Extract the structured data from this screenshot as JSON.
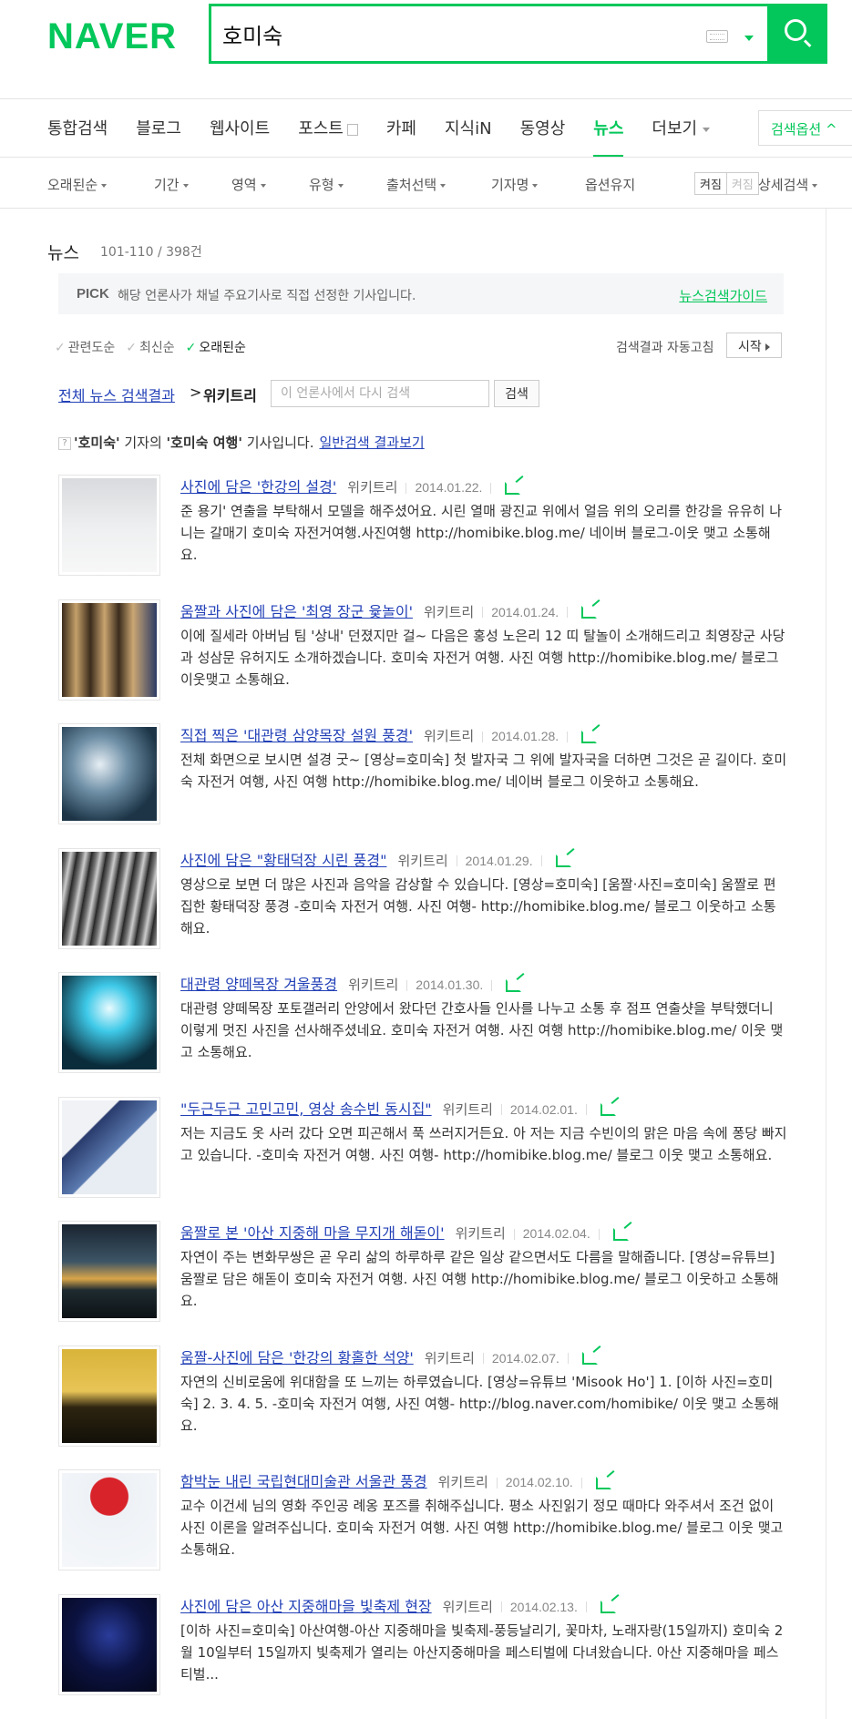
{
  "header": {
    "logo": "NAVER",
    "search_value": "호미숙"
  },
  "tabs": [
    {
      "label": "통합검색"
    },
    {
      "label": "블로그"
    },
    {
      "label": "웹사이트"
    },
    {
      "label": "포스트"
    },
    {
      "label": "카페"
    },
    {
      "label": "지식iN"
    },
    {
      "label": "동영상"
    },
    {
      "label": "뉴스",
      "active": true
    },
    {
      "label": "더보기"
    }
  ],
  "search_options_label": "검색옵션",
  "filters": {
    "sort": "오래된순",
    "period": "기간",
    "area": "영역",
    "type": "유형",
    "source": "출처선택",
    "reporter": "기자명",
    "option_keep": "옵션유지",
    "toggle_on": "켜짐",
    "toggle_off": "켜짐",
    "detail": "상세검색"
  },
  "news": {
    "title": "뉴스",
    "count": "101-110 / 398건",
    "pick_badge": "PICK",
    "pick_text": "해당 언론사가 채널 주요기사로 직접 선정한 기사입니다.",
    "pick_guide": "뉴스검색가이드",
    "sorts": [
      "관련도순",
      "최신순",
      "오래된순"
    ],
    "auto_refresh_label": "검색결과 자동고침",
    "auto_refresh_button": "시작",
    "breadcrumb_all": "전체 뉴스 검색결과",
    "breadcrumb_sep": ">",
    "breadcrumb_current": "위키트리",
    "in_search_placeholder": "이 언론사에서 다시 검색",
    "in_search_button": "검색",
    "notice_pre": "'호미숙'",
    "notice_mid": " 기자의 ",
    "notice_kw": "'호미숙 여행'",
    "notice_post": " 기사입니다.",
    "notice_link": "일반검색 결과보기"
  },
  "results": [
    {
      "headline": "사진에 담은 '한강의 설경'",
      "press": "위키트리",
      "date": "2014.01.22.",
      "thumb": "snow",
      "desc": "준 용기' 연출을 부탁해서 모델을 해주셨어요. 시린 열매 광진교 위에서 얼음 위의 오리를 한강을 유유히 나니는 갈매기 호미숙 자전거여행.사진여행 http://homibike.blog.me/ 네이버 블로그-이웃 맺고 소통해요."
    },
    {
      "headline": "움짤과 사진에 담은 '최영 장군 윷놀이'",
      "press": "위키트리",
      "date": "2014.01.24.",
      "thumb": "yut",
      "desc": "이에 질세라 아버님 팀 '상내' 던졌지만 걸~ 다음은 홍성 노은리 12 띠 탈놀이 소개해드리고 최영장군 사당과 성삼문 유허지도 소개하겠습니다. 호미숙 자전거 여행. 사진 여행 http://homibike.blog.me/ 블로그 이웃맺고 소통해요."
    },
    {
      "headline": "직접 찍은 '대관령 삼양목장 설원 풍경'",
      "press": "위키트리",
      "date": "2014.01.28.",
      "thumb": "sky",
      "desc": "전체 화면으로 보시면 설경 굿~ [영상=호미숙] 첫 발자국 그 위에 발자국을 더하면 그것은 곧 길이다. 호미숙 자전거 여행, 사진 여행 http://homibike.blog.me/ 네이버 블로그 이웃하고 소통해요."
    },
    {
      "headline": "사진에 담은 \"황태덕장 시린 풍경\"",
      "press": "위키트리",
      "date": "2014.01.29.",
      "thumb": "fish",
      "desc": "영상으로 보면 더 많은 사진과 음악을 감상할 수 있습니다. [영상=호미숙] [움짤·사진=호미숙] 움짤로 편집한 황태덕장 풍경 -호미숙 자전거 여행. 사진 여행- http://homibike.blog.me/ 블로그 이웃하고 소통해요."
    },
    {
      "headline": "대관령 양떼목장 겨울풍경",
      "press": "위키트리",
      "date": "2014.01.30.",
      "thumb": "jump",
      "desc": "대관령 양떼목장 포토갤러리 안양에서 왔다던 간호사들 인사를 나누고 소통 후 점프 연출샷을 부탁했더니 이렇게 멋진 사진을 선사해주셨네요. 호미숙 자전거 여행. 사진 여행 http://homibike.blog.me/ 이웃 맺고 소통해요."
    },
    {
      "headline": "\"두근두근 고민고민, 영상 송수빈 동시집\"",
      "press": "위키트리",
      "date": "2014.02.01.",
      "thumb": "book",
      "desc": "저는 지금도 옷 사러 갔다 오면 피곤해서 푹 쓰러지거든요. 아 저는 지금 수빈이의 맑은 마음 속에 퐁당 빠지고 있습니다. -호미숙 자전거 여행. 사진 여행- http://homibike.blog.me/ 블로그 이웃 맺고 소통해요."
    },
    {
      "headline": "움짤로 본 '아산 지중해 마을 무지개 해돋이'",
      "press": "위키트리",
      "date": "2014.02.04.",
      "thumb": "sunrise",
      "desc": "자연이 주는 변화무쌍은 곧 우리 삶의 하루하루 같은 일상 같으면서도 다름을 말해줍니다. [영상=유튜브] 움짤로 담은 해돋이 호미숙 자전거 여행. 사진 여행 http://homibike.blog.me/ 블로그 이웃하고 소통해요."
    },
    {
      "headline": "움짤-사진에 담은 '한강의 황홀한 석양'",
      "press": "위키트리",
      "date": "2014.02.07.",
      "thumb": "sunset",
      "desc": "자연의 신비로움에 위대함을 또 느끼는 하루였습니다. [영상=유튜브 'Misook Ho'] 1. [이하 사진=호미숙] 2. 3. 4. 5. -호미숙 자전거 여행, 사진 여행- http://blog.naver.com/homibike/ 이웃 맺고 소통해요."
    },
    {
      "headline": "함박눈 내린 국립현대미술관 서울관 풍경",
      "press": "위키트리",
      "date": "2014.02.10.",
      "thumb": "umbrella",
      "desc": "교수 이건세 님의 영화 주인공 례옹 포즈를 취해주십니다. 평소 사진읽기 정모 때마다 와주셔서 조건 없이 사진 이론을 알려주십니다. 호미숙 자전거 여행. 사진 여행 http://homibike.blog.me/ 블로그 이웃 맺고 소통해요."
    },
    {
      "headline": "사진에 담은 아산 지중해마을 빛축제 현장",
      "press": "위키트리",
      "date": "2014.02.13.",
      "thumb": "lights",
      "desc": "[이하 사진=호미숙] 아산여행-아산 지중해마을 빛축제-풍등날리기, 꽃마차, 노래자랑(15일까지) 호미숙 2월 10일부터 15일까지 빛축제가 열리는 아산지중해마을 페스티벌에 다녀왔습니다. 아산 지중해마을 페스티벌..."
    }
  ],
  "colors": {
    "brand": "#03c75a",
    "link": "#2341b7"
  }
}
